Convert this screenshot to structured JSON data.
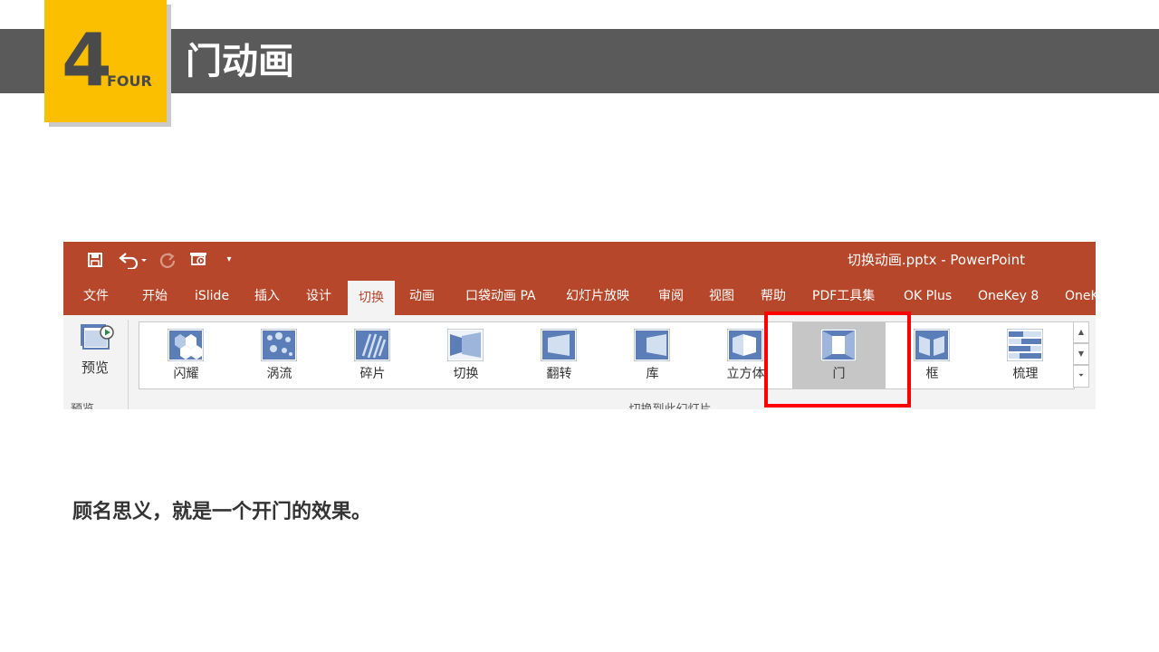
{
  "slide": {
    "badge_number": "4",
    "badge_word": "FOUR",
    "title": "门动画",
    "caption": "顾名思义，就是一个开门的效果。"
  },
  "window": {
    "doc_title": "切换动画.pptx  -  PowerPoint"
  },
  "quick_access": [
    {
      "name": "save-icon",
      "glyph": "🖫"
    },
    {
      "name": "undo-icon",
      "glyph": "↶"
    },
    {
      "name": "redo-icon",
      "glyph": "↻"
    },
    {
      "name": "present-icon",
      "glyph": "⎚"
    },
    {
      "name": "customize-icon",
      "glyph": "▾"
    }
  ],
  "tabs": [
    {
      "label": "文件",
      "active": false
    },
    {
      "label": "开始",
      "active": false
    },
    {
      "label": "iSlide",
      "active": false
    },
    {
      "label": "插入",
      "active": false
    },
    {
      "label": "设计",
      "active": false
    },
    {
      "label": "切换",
      "active": true
    },
    {
      "label": "动画",
      "active": false
    },
    {
      "label": "口袋动画 PA",
      "active": false
    },
    {
      "label": "幻灯片放映",
      "active": false
    },
    {
      "label": "审阅",
      "active": false
    },
    {
      "label": "视图",
      "active": false
    },
    {
      "label": "帮助",
      "active": false
    },
    {
      "label": "PDF工具集",
      "active": false
    },
    {
      "label": "OK Plus",
      "active": false
    },
    {
      "label": "OneKey 8",
      "active": false
    },
    {
      "label": "OneKey",
      "active": false
    }
  ],
  "preview": {
    "button_label": "预览",
    "group_label": "预览"
  },
  "transitions_group_label": "切换到此幻灯片",
  "effects": [
    {
      "label": "闪耀",
      "icon": "shimmer-icon",
      "selected": false
    },
    {
      "label": "涡流",
      "icon": "vortex-icon",
      "selected": false
    },
    {
      "label": "碎片",
      "icon": "shred-icon",
      "selected": false
    },
    {
      "label": "切换",
      "icon": "switch-icon",
      "selected": false
    },
    {
      "label": "翻转",
      "icon": "flip-icon",
      "selected": false
    },
    {
      "label": "库",
      "icon": "gallery-icon",
      "selected": false
    },
    {
      "label": "立方体",
      "icon": "cube-icon",
      "selected": false
    },
    {
      "label": "门",
      "icon": "doors-icon",
      "selected": true
    },
    {
      "label": "框",
      "icon": "box-icon",
      "selected": false
    },
    {
      "label": "梳理",
      "icon": "comb-icon",
      "selected": false
    }
  ],
  "colors": {
    "header_band": "#5a5a5a",
    "badge": "#fcbf00",
    "ribbon_accent": "#b7472a",
    "highlight": "#ff0000"
  }
}
